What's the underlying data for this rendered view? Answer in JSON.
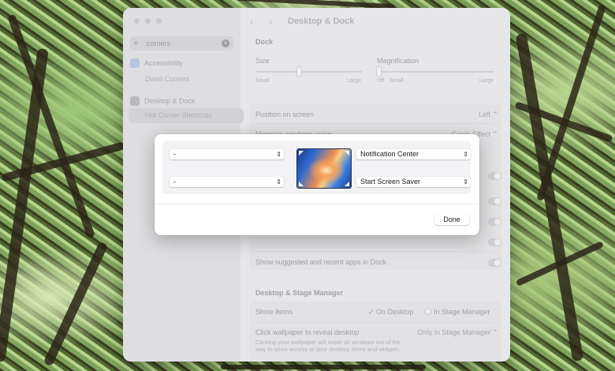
{
  "sidebar": {
    "search": {
      "value": "corners"
    },
    "groups": [
      {
        "label": "Accessibility",
        "subitem": "Dwell Corners"
      },
      {
        "label": "Desktop & Dock",
        "subitem": "Hot Corner Shortcuts"
      }
    ]
  },
  "header": {
    "title": "Desktop & Dock"
  },
  "dock": {
    "section_title": "Dock",
    "size": {
      "label": "Size",
      "min": "Small",
      "max": "Large"
    },
    "magnification": {
      "label": "Magnification",
      "off": "Off",
      "min": "Small",
      "max": "Large"
    },
    "position": {
      "label": "Position on screen",
      "value": "Left"
    },
    "minimize": {
      "label": "Minimize windows using",
      "value": "Genie Effect"
    },
    "suggested": {
      "label": "Show suggested and recent apps in Dock"
    }
  },
  "stage": {
    "section_title": "Desktop & Stage Manager",
    "show_items": {
      "label": "Show Items",
      "opt1": "On Desktop",
      "opt2": "In Stage Manager"
    },
    "click_wallpaper": {
      "label": "Click wallpaper to reveal desktop",
      "value": "Only in Stage Manager",
      "description": "Clicking your wallpaper will move all windows out of the way to allow access to your desktop items and widgets."
    }
  },
  "hot_corners": {
    "top_left": "-",
    "top_right": "Notification Center",
    "bottom_left": "-",
    "bottom_right": "Start Screen Saver",
    "done_label": "Done"
  },
  "colors": {
    "sheet_bg": "#ffffff",
    "panel_bg": "#f3f3f5",
    "dimmed_window": "#e7e7e9"
  }
}
